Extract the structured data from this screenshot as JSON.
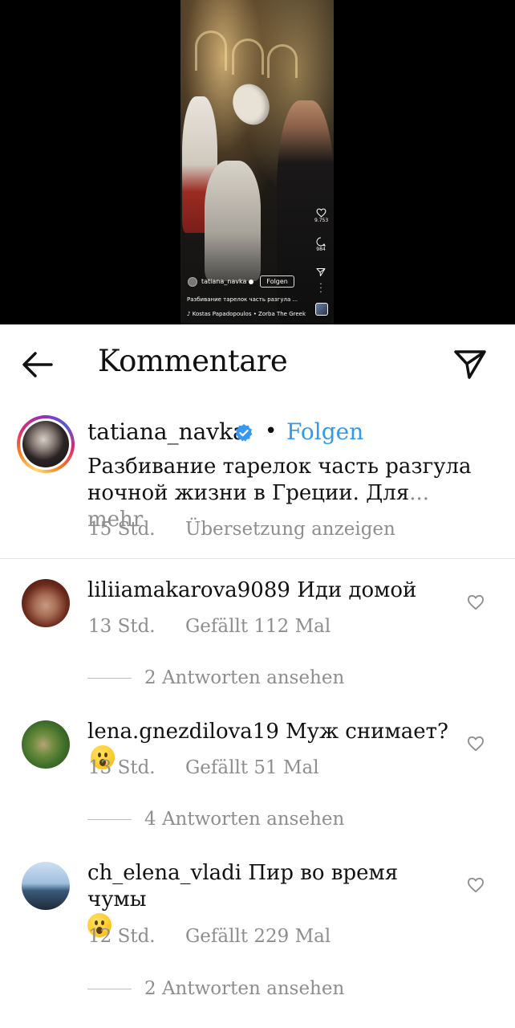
{
  "video": {
    "author": "tatiana_navka",
    "follow_label": "Folgen",
    "likes": "9.753",
    "comments": "984",
    "caption": "Разбивание тарелок часть разгула ...",
    "music": "Kostas Papadopoulos • Zorba The Greek"
  },
  "header": {
    "title": "Kommentare"
  },
  "post": {
    "username": "tatiana_navka",
    "separator": "•",
    "follow_label": "Folgen",
    "caption": "Разбивание тарелок часть разгула ночной жизни в Греции.  Для",
    "more_label": "... mehr",
    "time": "15 Std.",
    "translate_label": "Übersetzung anzeigen"
  },
  "comments": [
    {
      "username": "liliiamakarova9089",
      "text": "Иди домой",
      "time": "13 Std.",
      "likes": "Gefällt 112 Mal",
      "replies": "2 Antworten ansehen",
      "emoji": ""
    },
    {
      "username": "lena.gnezdilova19",
      "text": "Муж снимает?",
      "time": "13 Std.",
      "likes": "Gefällt 51 Mal",
      "replies": "4 Antworten ansehen",
      "emoji": "😯"
    },
    {
      "username": "ch_elena_vladi",
      "text": "Пир во время чумы",
      "time": "12 Std.",
      "likes": "Gefällt 229 Mal",
      "replies": "2 Antworten ansehen",
      "emoji": "😯"
    }
  ],
  "colors": {
    "link_blue": "#2f9bf0",
    "verified_blue": "#3897f0",
    "meta_gray": "#8e8e8e"
  }
}
